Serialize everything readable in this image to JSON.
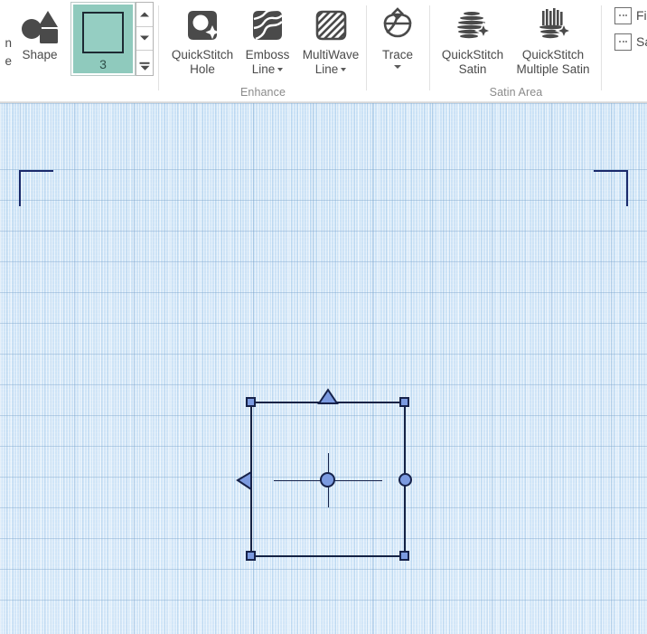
{
  "app": {
    "ribbon": {
      "clipped_left_lines": [
        "n",
        "e"
      ],
      "groups": [
        {
          "name": "shape-group",
          "title": "",
          "shape_button_label": "Shape",
          "shape_number": "3",
          "spinner_up_icon": "triangle-up-icon",
          "spinner_down_icon": "triangle-down-icon",
          "spinner_list_icon": "dropdown-list-icon"
        },
        {
          "name": "enhance-group",
          "title": "Enhance",
          "commands": [
            {
              "label_line1": "QuickStitch",
              "label_line2": "Hole",
              "icon": "quickstitch-hole-icon",
              "has_caret": false
            },
            {
              "label_line1": "Emboss",
              "label_line2": "Line",
              "icon": "emboss-line-icon",
              "has_caret": true
            },
            {
              "label_line1": "MultiWave",
              "label_line2": "Line",
              "icon": "multiwave-line-icon",
              "has_caret": true
            }
          ]
        },
        {
          "name": "trace-group",
          "title": "",
          "commands": [
            {
              "label_line1": "Trace",
              "label_line2": "",
              "icon": "trace-icon",
              "has_caret_below": true
            }
          ]
        },
        {
          "name": "satin-area-group",
          "title": "Satin Area",
          "commands": [
            {
              "label_line1": "QuickStitch",
              "label_line2": "Satin",
              "icon": "quickstitch-satin-icon",
              "has_caret": false
            },
            {
              "label_line1": "QuickStitch",
              "label_line2": "Multiple Satin",
              "icon": "quickstitch-multiple-satin-icon",
              "has_caret": false
            }
          ]
        },
        {
          "name": "clipped-right-group",
          "title": "",
          "small_buttons": [
            {
              "label": "Fi",
              "icon": "ellipsis-box-icon"
            },
            {
              "label": "Sa",
              "icon": "ellipsis-box-icon"
            }
          ]
        }
      ]
    },
    "canvas": {
      "name": "embroidery-design-canvas",
      "background_color": "#cfe4f7",
      "hoop_bracket_color": "#1b2a6b",
      "selection": {
        "name": "selected-shape-bounding-box",
        "outline_color": "#152244",
        "handle_fill": "#7b9ae0",
        "handle_border": "#16224a",
        "handles": [
          "resize-handle-top-left",
          "resize-handle-top-right",
          "resize-handle-bottom-left",
          "resize-handle-bottom-right",
          "rotate-handle-top",
          "skew-handle-left",
          "scale-handle-right",
          "center-origin-handle"
        ]
      }
    }
  }
}
